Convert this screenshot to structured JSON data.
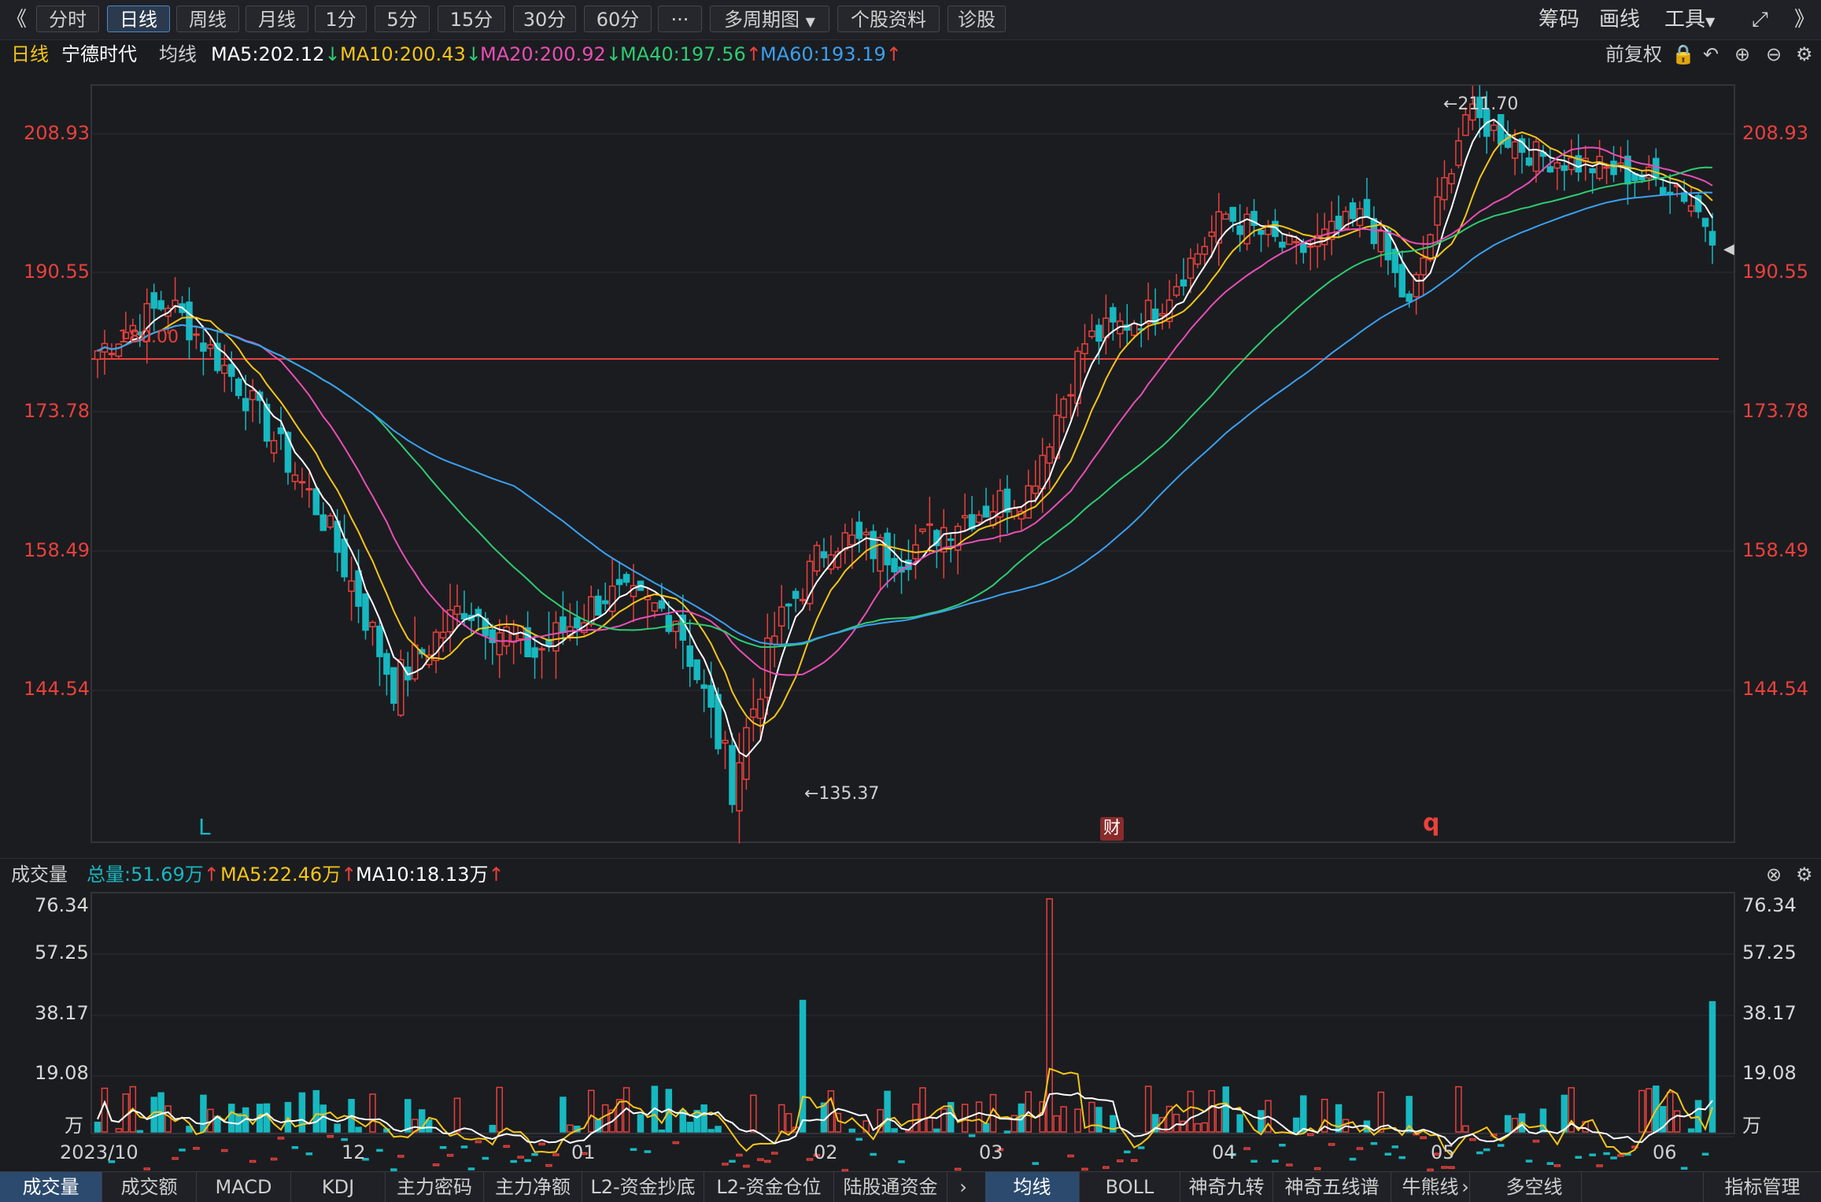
{
  "toolbar": {
    "back_icon": "double-chevron-left-icon",
    "periods": [
      "分时",
      "日线",
      "周线",
      "月线",
      "1分",
      "5分",
      "15分",
      "30分",
      "60分"
    ],
    "active_period": "日线",
    "more_label": "···",
    "multi_period": "多周期图",
    "stock_info": "个股资料",
    "diagnose": "诊股",
    "right_items": [
      "筹码",
      "画线",
      "工具"
    ],
    "right_icons": [
      "expand-icon",
      "double-chevron-right-icon"
    ]
  },
  "ma_bar": {
    "period": "日线",
    "stock": "宁德时代",
    "label": "均线",
    "ma5": "MA5:202.12",
    "ma10": "MA10:200.43",
    "ma20": "MA20:200.92",
    "ma40": "MA40:197.56",
    "ma60": "MA60:193.19",
    "adjust": "前复权",
    "colors": {
      "ma5": "#ffffff",
      "ma10": "#f5c518",
      "ma20": "#e84fb4",
      "ma40": "#2ecc71",
      "ma60": "#3aa0f0"
    }
  },
  "price_axis": {
    "ticks": [
      "208.93",
      "190.55",
      "173.78",
      "158.49",
      "144.54"
    ],
    "high_label": "←211.70",
    "low_label": "←135.37",
    "line_label": "180.00",
    "markers": {
      "L": "L",
      "cai": "财",
      "q": "q"
    }
  },
  "volume": {
    "label": "成交量",
    "total": "总量:51.69万",
    "ma5": "MA5:22.46万",
    "ma10": "MA10:18.13万",
    "ticks": [
      "76.34",
      "57.25",
      "38.17",
      "19.08"
    ],
    "unit": "万"
  },
  "dates": [
    "2023/10",
    "12",
    "01",
    "02",
    "03",
    "04",
    "05",
    "06"
  ],
  "bottom_tabs_left": [
    "成交量",
    "成交额",
    "MACD",
    "KDJ",
    "主力密码",
    "主力净额",
    "L2-资金抄底",
    "L2-资金仓位",
    "陆股通资金"
  ],
  "bottom_tabs_right": [
    "均线",
    "BOLL",
    "神奇九转",
    "神奇五线谱",
    "牛熊线",
    "多空线"
  ],
  "indicator_mgmt": "指标管理",
  "chart_data": {
    "type": "candlestick",
    "symbol": "宁德时代",
    "ylim": [
      130,
      216
    ],
    "ticks": [
      208.93,
      190.55,
      173.78,
      158.49,
      144.54
    ],
    "ma_latest": {
      "MA5": 202.12,
      "MA10": 200.43,
      "MA20": 200.92,
      "MA40": 197.56,
      "MA60": 193.19
    },
    "highest": 211.7,
    "lowest": 135.37,
    "reference_line": 180.0,
    "volume_ticks": [
      76.34,
      57.25,
      38.17,
      19.08
    ],
    "volume_latest": 51.69
  }
}
